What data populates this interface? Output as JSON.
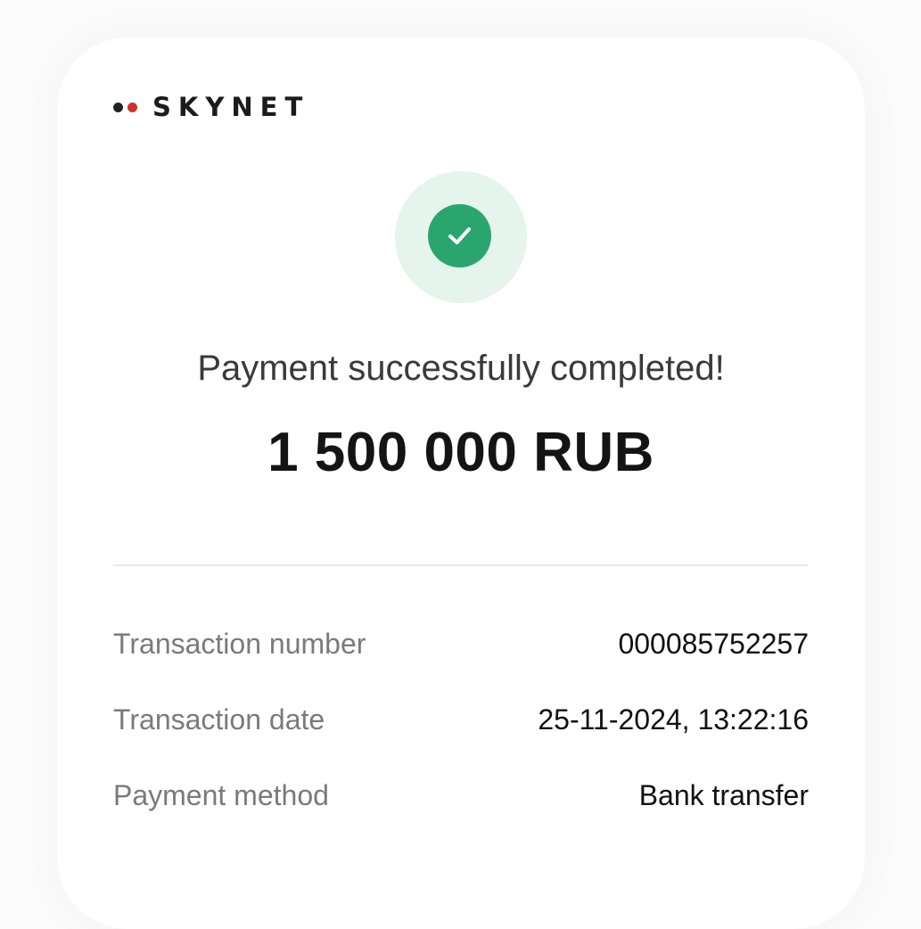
{
  "brand": {
    "name": "SKYNET",
    "dot_colors": [
      "#222222",
      "#d2302a"
    ]
  },
  "status": {
    "icon": "checkmark-icon",
    "accent_color": "#2aa56e",
    "message": "Payment successfully completed!"
  },
  "amount": "1 500 000 RUB",
  "details": [
    {
      "label": "Transaction number",
      "value": "000085752257"
    },
    {
      "label": "Transaction date",
      "value": "25-11-2024, 13:22:16"
    },
    {
      "label": "Payment method",
      "value": "Bank transfer"
    }
  ]
}
